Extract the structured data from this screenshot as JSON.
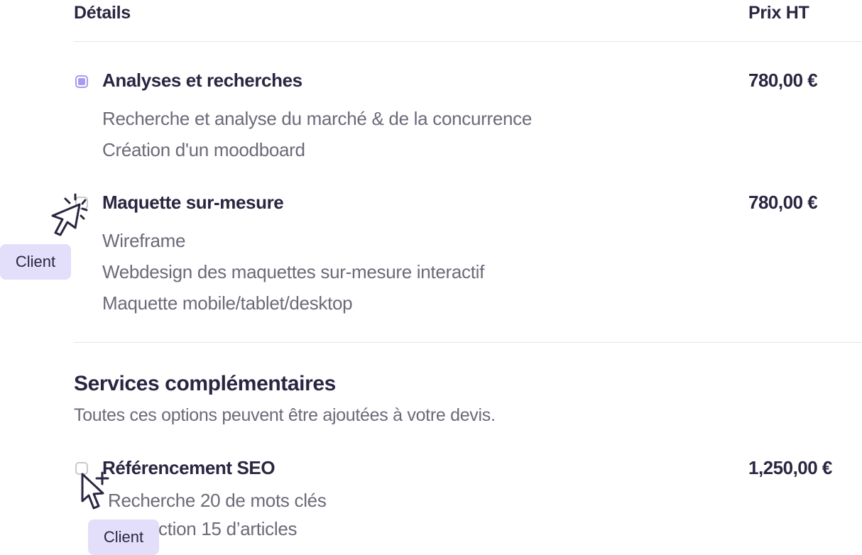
{
  "header": {
    "details_label": "Détails",
    "price_label": "Prix HT"
  },
  "items": [
    {
      "title": "Analyses et recherches",
      "price": "780,00 €",
      "checked": true,
      "lines": [
        "Recherche et analyse du marché & de la concurrence",
        "Création d'un moodboard"
      ]
    },
    {
      "title": "Maquette sur-mesure",
      "price": "780,00 €",
      "checked": false,
      "lines": [
        "Wireframe",
        "Webdesign des maquettes sur-mesure interactif",
        "Maquette mobile/tablet/desktop"
      ]
    }
  ],
  "extras": {
    "title": "Services complémentaires",
    "description": "Toutes ces options peuvent être ajoutées à votre devis.",
    "items": [
      {
        "title": "Référencement SEO",
        "price": "1,250,00 €",
        "checked": false,
        "lines": [
          "Recherche 20 de mots clés",
          "ction 15 d’articles"
        ]
      }
    ]
  },
  "cursors": [
    {
      "label": "Client",
      "icon": "click-cursor-icon"
    },
    {
      "label": "Client",
      "icon": "add-cursor-icon"
    }
  ],
  "colors": {
    "accent": "#a89af0",
    "badge_bg": "#e3defa",
    "text": "#2b2541",
    "muted": "#6b6a78"
  }
}
